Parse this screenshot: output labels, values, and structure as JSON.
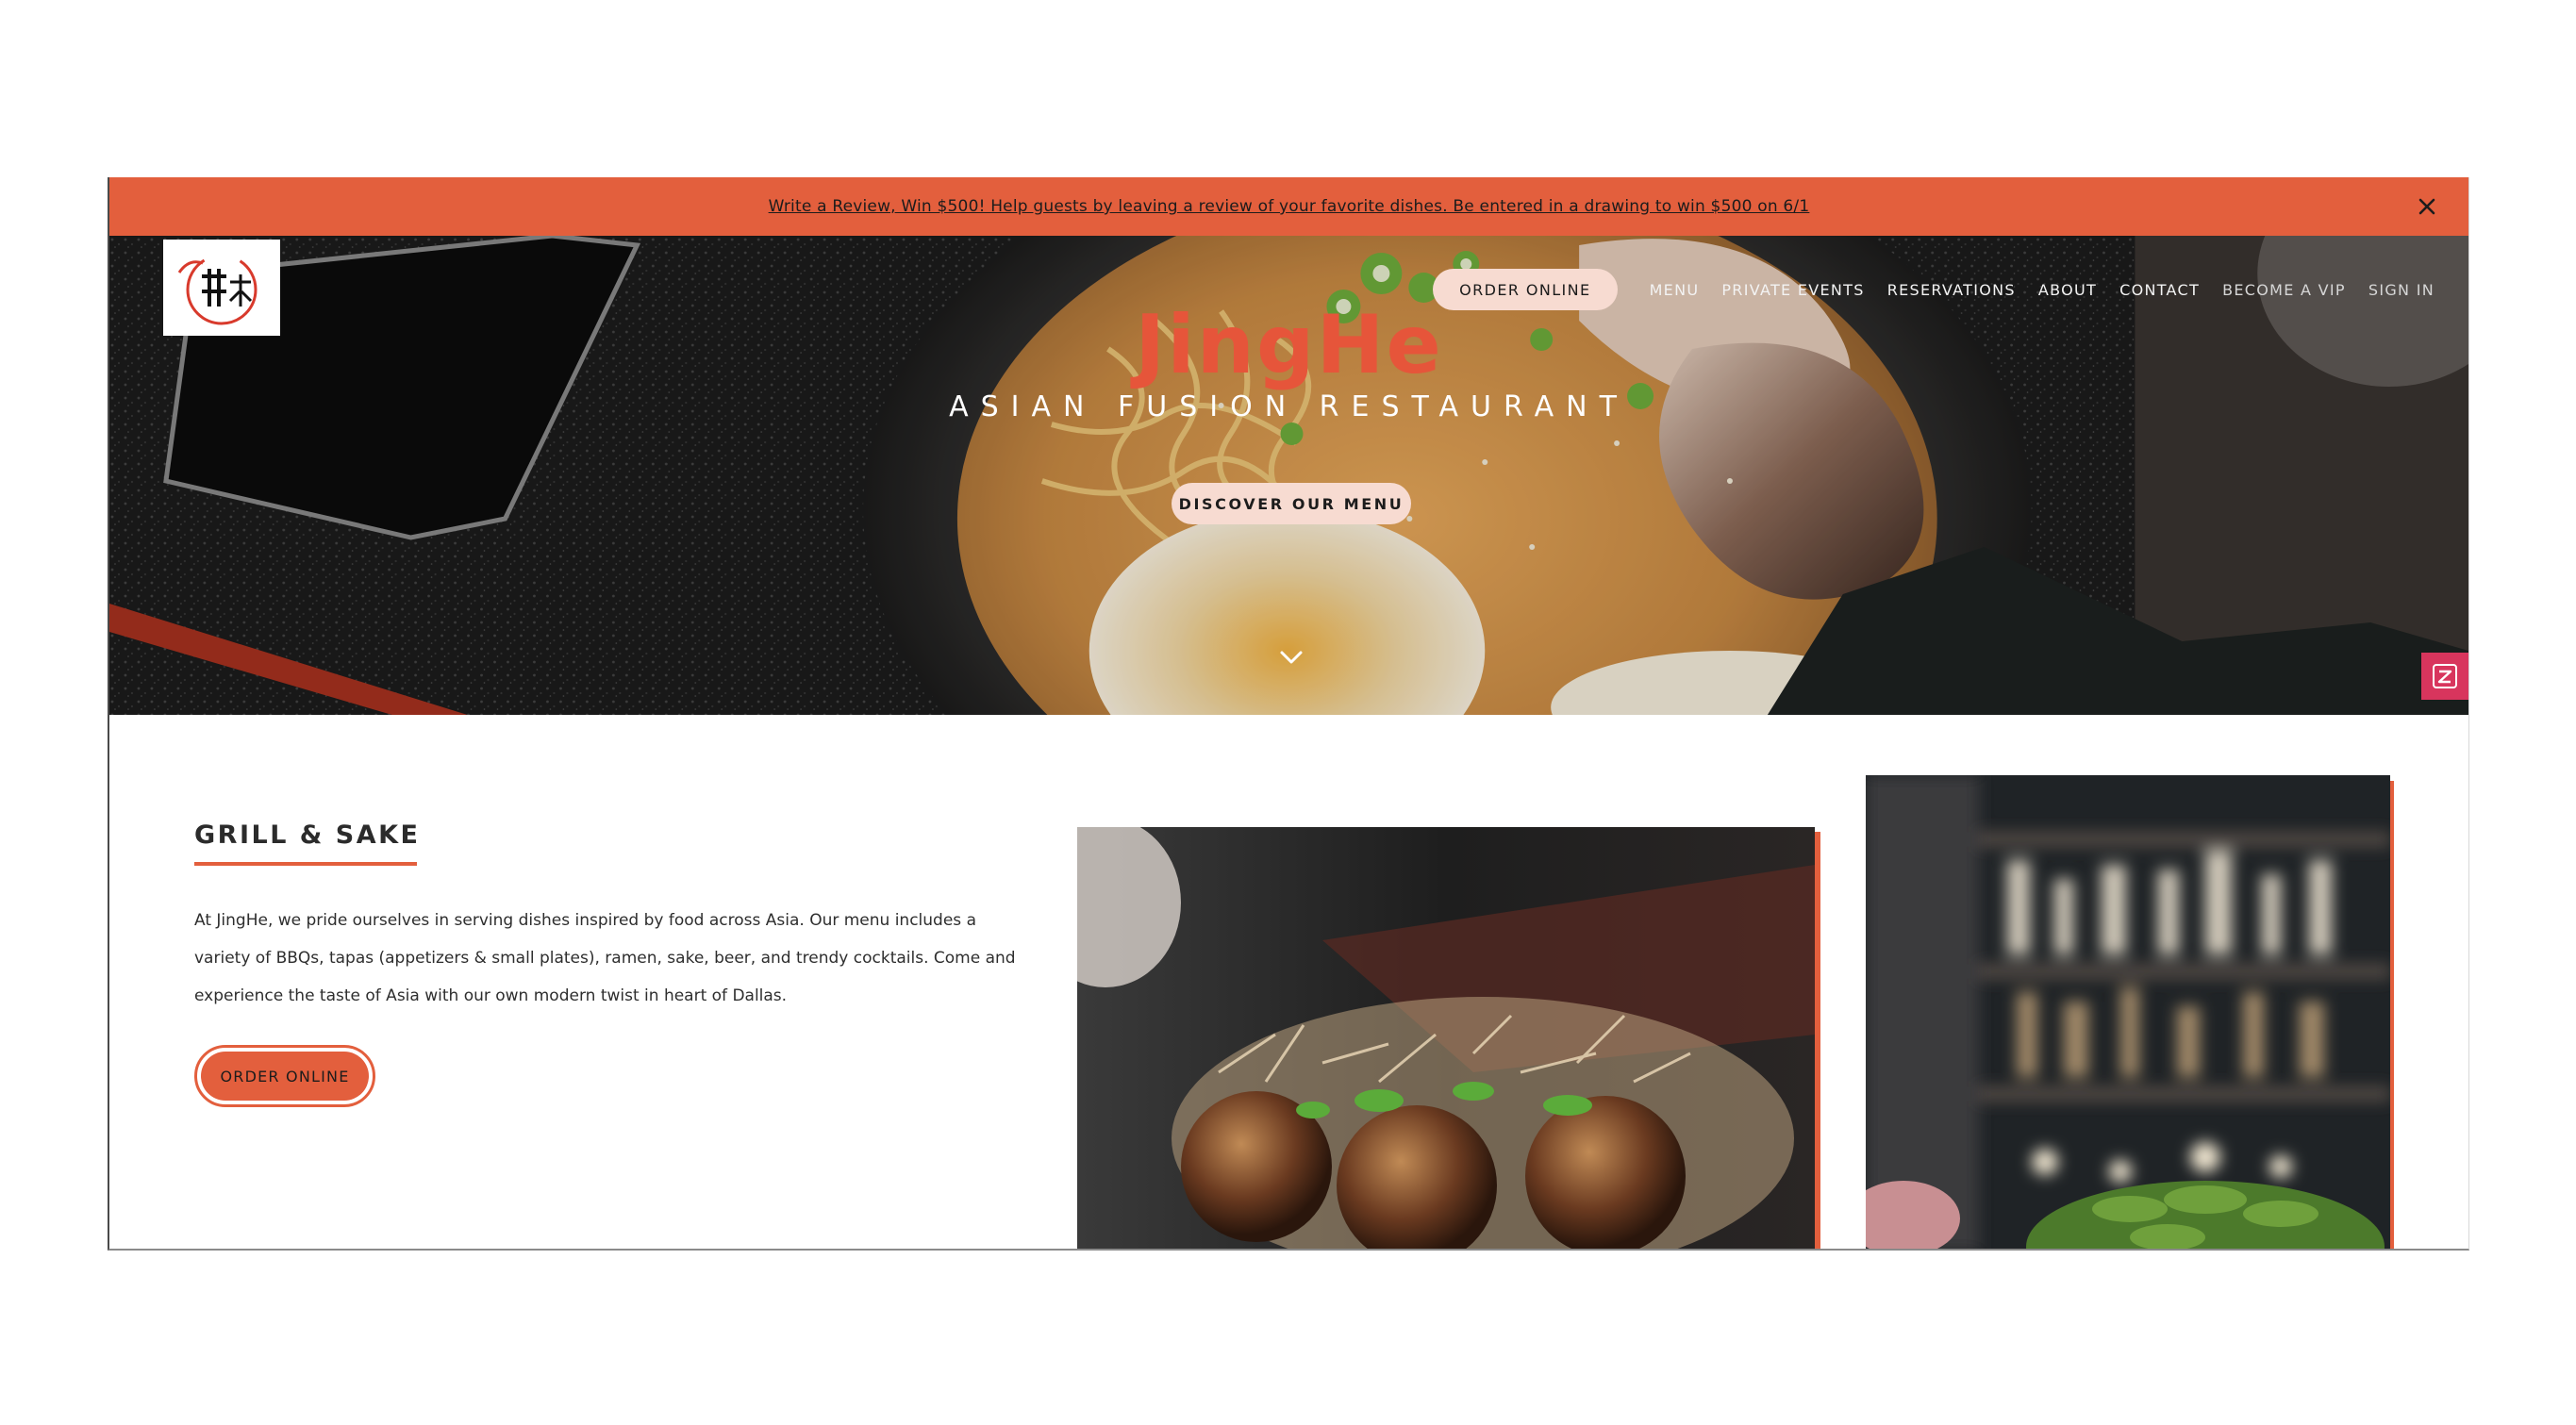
{
  "announcement": {
    "text": "Write a Review, Win $500! Help guests by leaving a review of your favorite dishes. Be entered in a drawing to win $500 on 6/1",
    "close_icon": "close-icon"
  },
  "brand": {
    "logo_icon": "jinghe-logo",
    "accent_color": "#e35f3d",
    "pill_color": "#f7dbd1"
  },
  "nav": {
    "order_online": "ORDER ONLINE",
    "items": [
      "MENU",
      "PRIVATE EVENTS",
      "RESERVATIONS",
      "ABOUT",
      "CONTACT",
      "BECOME A VIP",
      "SIGN IN"
    ]
  },
  "hero": {
    "title": "JingHe",
    "subtitle": "ASIAN FUSION RESTAURANT",
    "cta": "DISCOVER OUR MENU",
    "scroll_icon": "chevron-down-icon",
    "widget_icon": "zenchef-widget-icon"
  },
  "section": {
    "heading": "GRILL & SAKE",
    "body": "At JingHe, we pride ourselves in serving dishes inspired by food across Asia. Our menu includes a variety of BBQs, tapas (appetizers & small plates), ramen, sake, beer, and trendy cocktails. Come and experience the taste of Asia with our own modern twist in heart of Dallas.",
    "cta": "ORDER ONLINE"
  }
}
